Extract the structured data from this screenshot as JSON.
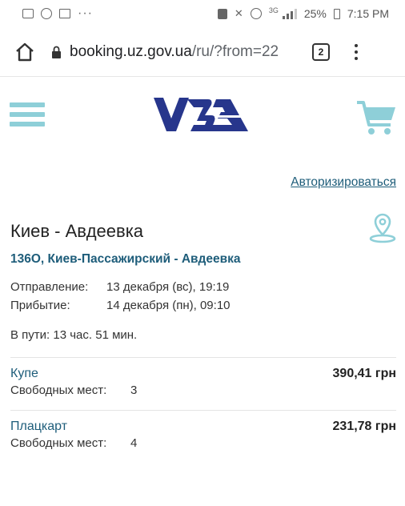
{
  "status_bar": {
    "icons": [
      "news-icon",
      "messenger-icon",
      "gallery-icon",
      "more-dots-icon"
    ],
    "right_icons": [
      "sim-icon",
      "mute-icon",
      "alarm-icon",
      "3g-signal-icon",
      "battery-icon"
    ],
    "network": "3G",
    "battery": "25%",
    "time": "7:15 PM"
  },
  "browser": {
    "url_host": "booking.uz.gov.ua",
    "url_path": "/ru/?from=22",
    "tab_count": "2"
  },
  "header": {
    "auth_link": "Авторизироваться"
  },
  "trip": {
    "title": "Киев - Авдеевка",
    "train": "136О, Киев-Пассажирский - Авдеевка",
    "departure_label": "Отправление:",
    "departure_value": "13 декабря (вс), 19:19",
    "arrival_label": "Прибытие:",
    "arrival_value": "14 декабря (пн), 09:10",
    "duration": "В пути: 13 час. 51 мин."
  },
  "classes": [
    {
      "name": "Купе",
      "price": "390,41 грн",
      "seats_label": "Свободных мест:",
      "seats": "3"
    },
    {
      "name": "Плацкарт",
      "price": "231,78 грн",
      "seats_label": "Свободных мест:",
      "seats": "4"
    }
  ],
  "colors": {
    "accent": "#1e5d7a",
    "logo_blue": "#27368c",
    "icon_teal": "#8ecfd8"
  }
}
